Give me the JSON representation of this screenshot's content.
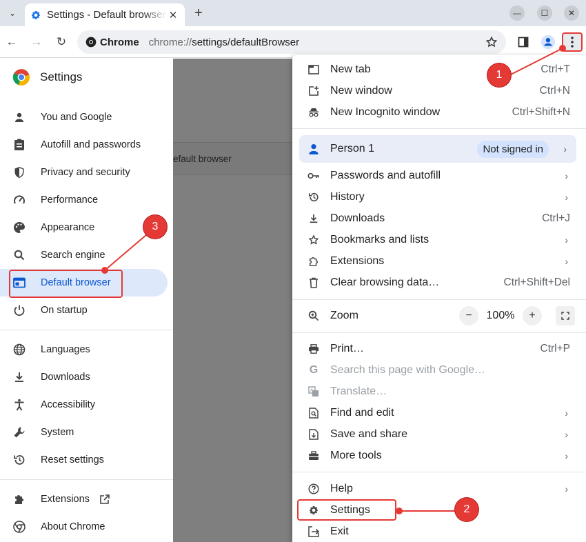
{
  "tab": {
    "title": "Settings - Default browser"
  },
  "toolbar": {
    "chip_label": "Chrome",
    "url_prefix": "chrome://",
    "url_path": "settings/defaultBrowser"
  },
  "sidebar": {
    "title": "Settings",
    "items": [
      {
        "label": "You and Google",
        "icon": "person-icon"
      },
      {
        "label": "Autofill and passwords",
        "icon": "clipboard-icon"
      },
      {
        "label": "Privacy and security",
        "icon": "shield-icon"
      },
      {
        "label": "Performance",
        "icon": "gauge-icon"
      },
      {
        "label": "Appearance",
        "icon": "palette-icon"
      },
      {
        "label": "Search engine",
        "icon": "search-icon"
      },
      {
        "label": "Default browser",
        "icon": "browser-icon",
        "active": true
      },
      {
        "label": "On startup",
        "icon": "power-icon"
      },
      {
        "label": "Languages",
        "icon": "globe-icon"
      },
      {
        "label": "Downloads",
        "icon": "download-icon"
      },
      {
        "label": "Accessibility",
        "icon": "accessibility-icon"
      },
      {
        "label": "System",
        "icon": "wrench-icon"
      },
      {
        "label": "Reset settings",
        "icon": "restore-icon"
      },
      {
        "label": "Extensions",
        "icon": "puzzle-icon"
      },
      {
        "label": "About Chrome",
        "icon": "chrome-icon"
      }
    ]
  },
  "main": {
    "card_text": "efault browser"
  },
  "menu": {
    "new_tab": {
      "label": "New tab",
      "shortcut": "Ctrl+T"
    },
    "new_window": {
      "label": "New window",
      "shortcut": "Ctrl+N"
    },
    "incognito": {
      "label": "New Incognito window",
      "shortcut": "Ctrl+Shift+N"
    },
    "person": {
      "label": "Person 1",
      "badge": "Not signed in"
    },
    "passwords": {
      "label": "Passwords and autofill"
    },
    "history": {
      "label": "History"
    },
    "downloads": {
      "label": "Downloads",
      "shortcut": "Ctrl+J"
    },
    "bookmarks": {
      "label": "Bookmarks and lists"
    },
    "extensions": {
      "label": "Extensions"
    },
    "clear": {
      "label": "Clear browsing data…",
      "shortcut": "Ctrl+Shift+Del"
    },
    "zoom": {
      "label": "Zoom",
      "value": "100%",
      "minus": "−",
      "plus": "+"
    },
    "print": {
      "label": "Print…",
      "shortcut": "Ctrl+P"
    },
    "search_google": {
      "label": "Search this page with Google…"
    },
    "translate": {
      "label": "Translate…"
    },
    "find_edit": {
      "label": "Find and edit"
    },
    "save_share": {
      "label": "Save and share"
    },
    "more_tools": {
      "label": "More tools"
    },
    "help": {
      "label": "Help"
    },
    "settings": {
      "label": "Settings"
    },
    "exit": {
      "label": "Exit"
    }
  },
  "annotations": {
    "step1": "1",
    "step2": "2",
    "step3": "3"
  },
  "colors": {
    "accent": "#0b57d0",
    "annotation": "#e53935",
    "active_bg": "#dde8fb"
  }
}
